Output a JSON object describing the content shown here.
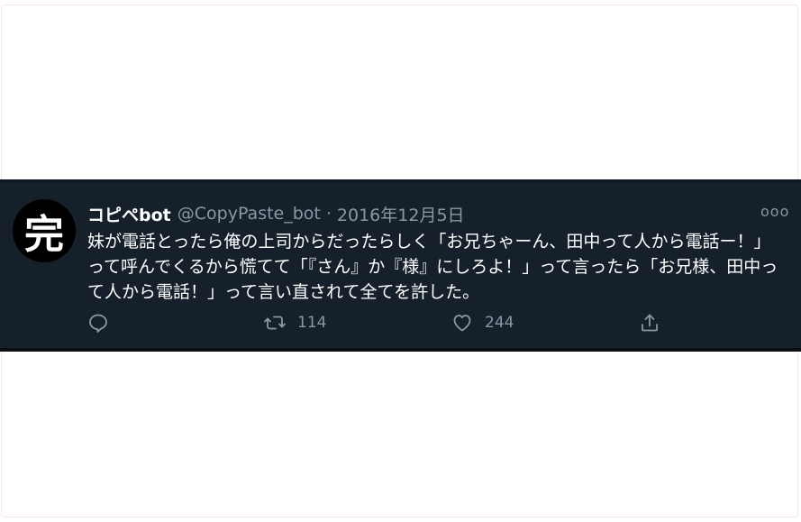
{
  "tweet": {
    "avatar_glyph": "完",
    "display_name": "コピペbot",
    "handle": "@CopyPaste_bot",
    "separator": "·",
    "date": "2016年12月5日",
    "more_label": "ooo",
    "text": "妹が電話とったら俺の上司からだったらしく「お兄ちゃーん、田中って人から電話ー！」って呼んでくるから慌てて「『さん』か『様』にしろよ！」って言ったら「お兄様、田中って人から電話！」って言い直されて全てを許した。",
    "actions": {
      "reply_icon": "reply-icon",
      "retweet_icon": "retweet-icon",
      "retweet_count": "114",
      "like_icon": "heart-icon",
      "like_count": "244",
      "share_icon": "share-icon"
    }
  },
  "colors": {
    "page_background": "#ffffff",
    "tweet_background": "#15202b",
    "secondary_text": "#8899a6",
    "primary_text": "#ffffff"
  }
}
